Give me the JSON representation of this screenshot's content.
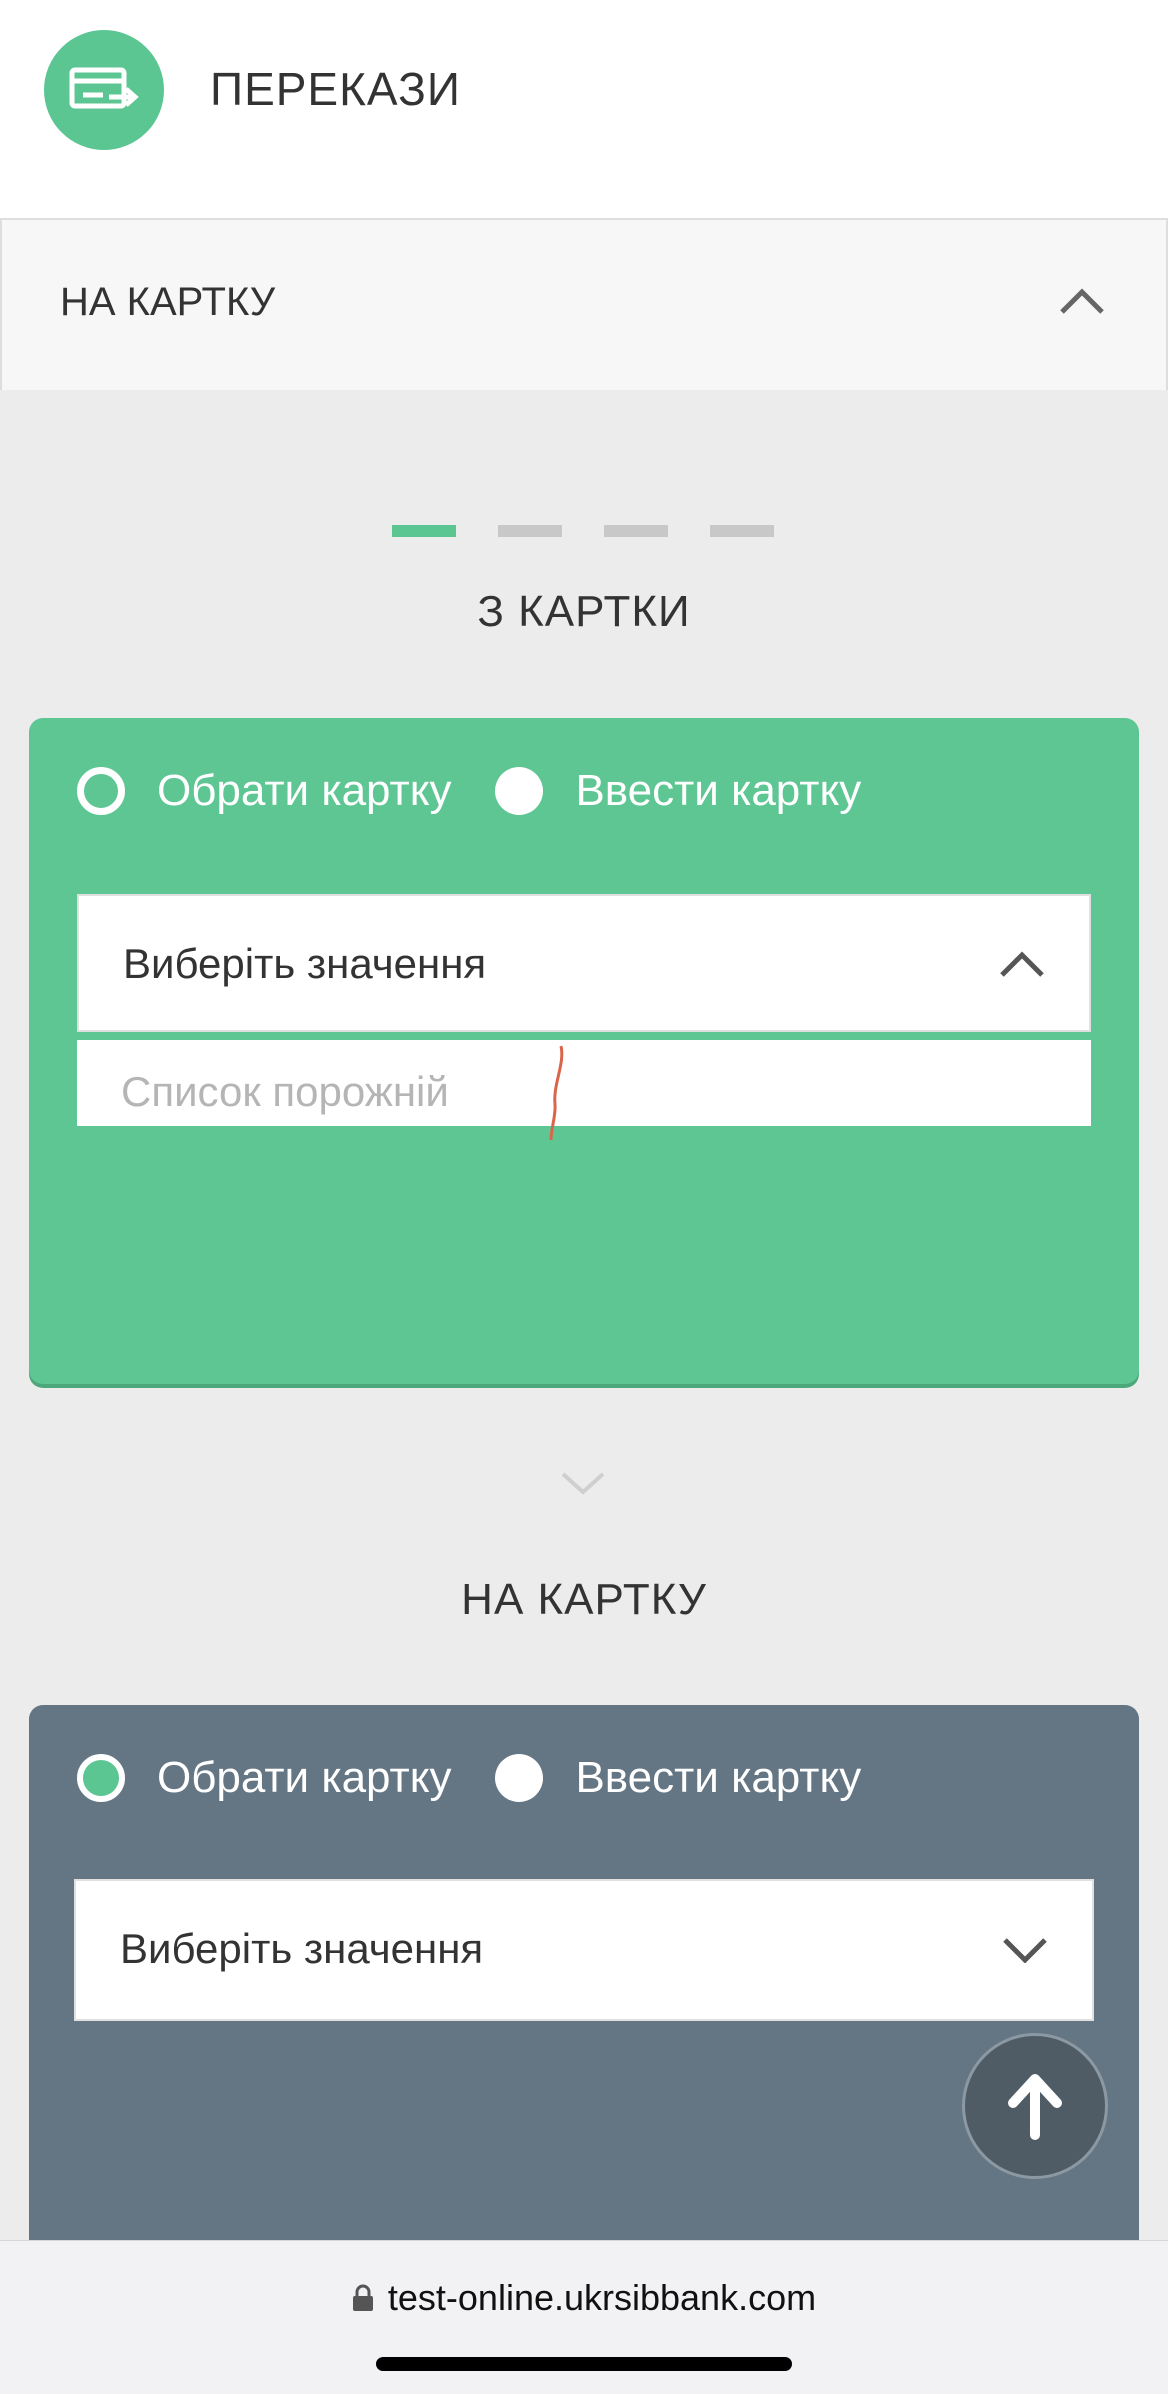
{
  "header": {
    "title": "ПЕРЕКАЗИ",
    "icon": "transfer-card-icon",
    "icon_bg": "#5cc693"
  },
  "accordion": {
    "title": "НА КАРТКУ",
    "expanded": true
  },
  "stepper": {
    "total_steps": 4,
    "active_step": 1,
    "active_color": "#5cc693"
  },
  "from_card": {
    "title": "З КАРТКИ",
    "bg_color": "#5ec693",
    "radio_select_label": "Обрати картку",
    "radio_enter_label": "Ввести картку",
    "select_placeholder": "Виберіть значення",
    "dropdown_empty": "Список порожній"
  },
  "to_card": {
    "title": "НА КАРТКУ",
    "bg_color": "#647584",
    "radio_select_label": "Обрати картку",
    "radio_enter_label": "Ввести картку",
    "select_placeholder": "Виберіть значення"
  },
  "browser": {
    "url": "test-online.ukrsibbank.com"
  }
}
